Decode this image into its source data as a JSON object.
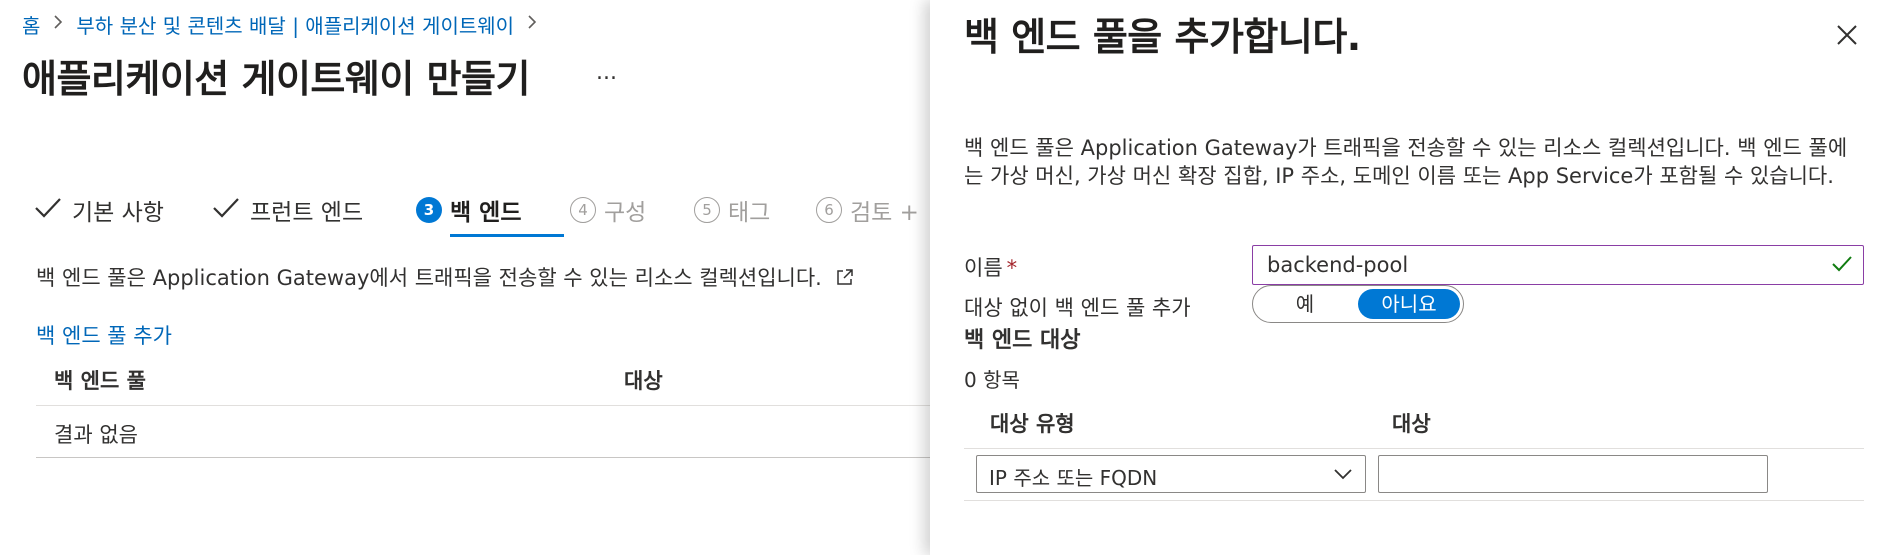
{
  "breadcrumb": {
    "home": "홈",
    "parent": "부하 분산 및 콘텐츠 배달 | 애플리케이션 게이트웨이",
    "separator": ">"
  },
  "page": {
    "title": "애플리케이션 게이트웨이 만들기",
    "more": "..."
  },
  "tabs": [
    {
      "label": "기본 사항",
      "state": "done"
    },
    {
      "label": "프런트 엔드",
      "state": "done"
    },
    {
      "number": "3",
      "label": "백 엔드",
      "state": "current"
    },
    {
      "number": "4",
      "label": "구성",
      "state": "disabled"
    },
    {
      "number": "5",
      "label": "태그",
      "state": "disabled"
    },
    {
      "number": "6",
      "label": "검토 +",
      "state": "disabled"
    }
  ],
  "main": {
    "description": "백 엔드 풀은 Application Gateway에서 트래픽을 전송할 수 있는 리소스 컬렉션입니다.",
    "add_pool_link": "백 엔드 풀 추가",
    "table": {
      "columns": [
        "백 엔드 풀",
        "대상"
      ],
      "empty_text": "결과 없음"
    }
  },
  "panel": {
    "title": "백 엔드 풀을 추가합니다.",
    "description": "백 엔드 풀은 Application Gateway가 트래픽을 전송할 수 있는 리소스 컬렉션입니다. 백 엔드 풀에는 가상 머신, 가상 머신 확장 집합, IP 주소, 도메인 이름 또는 App Service가 포함될 수 있습니다.",
    "name_label": "이름",
    "required_mark": "*",
    "name_value": "backend-pool",
    "no_target_label": "대상 없이 백 엔드 풀 추가",
    "toggle": {
      "yes": "예",
      "no": "아니요",
      "selected": "아니요"
    },
    "targets_title": "백 엔드 대상",
    "item_count": "0 항목",
    "targets_table": {
      "columns": [
        "대상 유형",
        "대상"
      ],
      "target_type_value": "IP 주소 또는 FQDN",
      "target_value": ""
    }
  },
  "colors": {
    "accent": "#0078d4",
    "link": "#0067b8",
    "valid": "#107c10",
    "focus_border": "#8a3ea5",
    "required": "#a4262c"
  },
  "icons": [
    "chevron-right-icon",
    "checkmark-icon",
    "external-link-icon",
    "close-icon",
    "chevron-down-icon"
  ]
}
